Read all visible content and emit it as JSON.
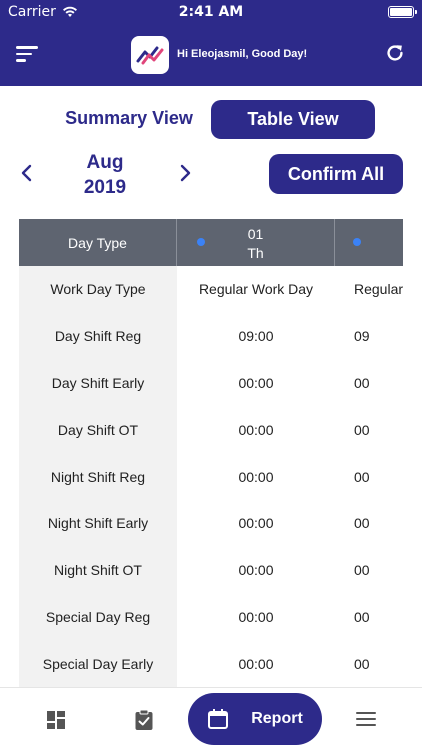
{
  "status_bar": {
    "carrier": "Carrier",
    "time": "2:41 AM"
  },
  "header": {
    "greeting": "Hi Eleojasmil, Good Day!"
  },
  "view_toggle": {
    "summary_label": "Summary View",
    "table_label": "Table View",
    "active": "Table View"
  },
  "period": {
    "month": "Aug",
    "year": "2019"
  },
  "actions": {
    "confirm_all_label": "Confirm All"
  },
  "table": {
    "header_label": "Day Type",
    "days": [
      {
        "num": "01",
        "name": "Th",
        "dot_color": "#3b82f6"
      },
      {
        "num": "",
        "name": "",
        "dot_color": "#3b82f6"
      }
    ],
    "rows": [
      {
        "label": "Work Day Type",
        "v1": "Regular Work Day",
        "v2": "Regular"
      },
      {
        "label": "Day Shift Reg",
        "v1": "09:00",
        "v2": "09"
      },
      {
        "label": "Day Shift Early",
        "v1": "00:00",
        "v2": "00"
      },
      {
        "label": "Day Shift OT",
        "v1": "00:00",
        "v2": "00"
      },
      {
        "label": "Night Shift Reg",
        "v1": "00:00",
        "v2": "00"
      },
      {
        "label": "Night Shift Early",
        "v1": "00:00",
        "v2": "00"
      },
      {
        "label": "Night Shift OT",
        "v1": "00:00",
        "v2": "00"
      },
      {
        "label": "Special Day Reg",
        "v1": "00:00",
        "v2": "00"
      },
      {
        "label": "Special Day Early",
        "v1": "00:00",
        "v2": "00"
      }
    ]
  },
  "tabbar": {
    "items": [
      {
        "icon": "dashboard-icon"
      },
      {
        "icon": "clipboard-check-icon"
      },
      {
        "icon": "calendar-icon",
        "label": "Report",
        "active": true
      },
      {
        "icon": "menu-icon"
      }
    ]
  },
  "colors": {
    "primary": "#2d2a8a",
    "table_header": "#5e6470",
    "label_column": "#f2f2f2",
    "dot": "#3b82f6"
  }
}
